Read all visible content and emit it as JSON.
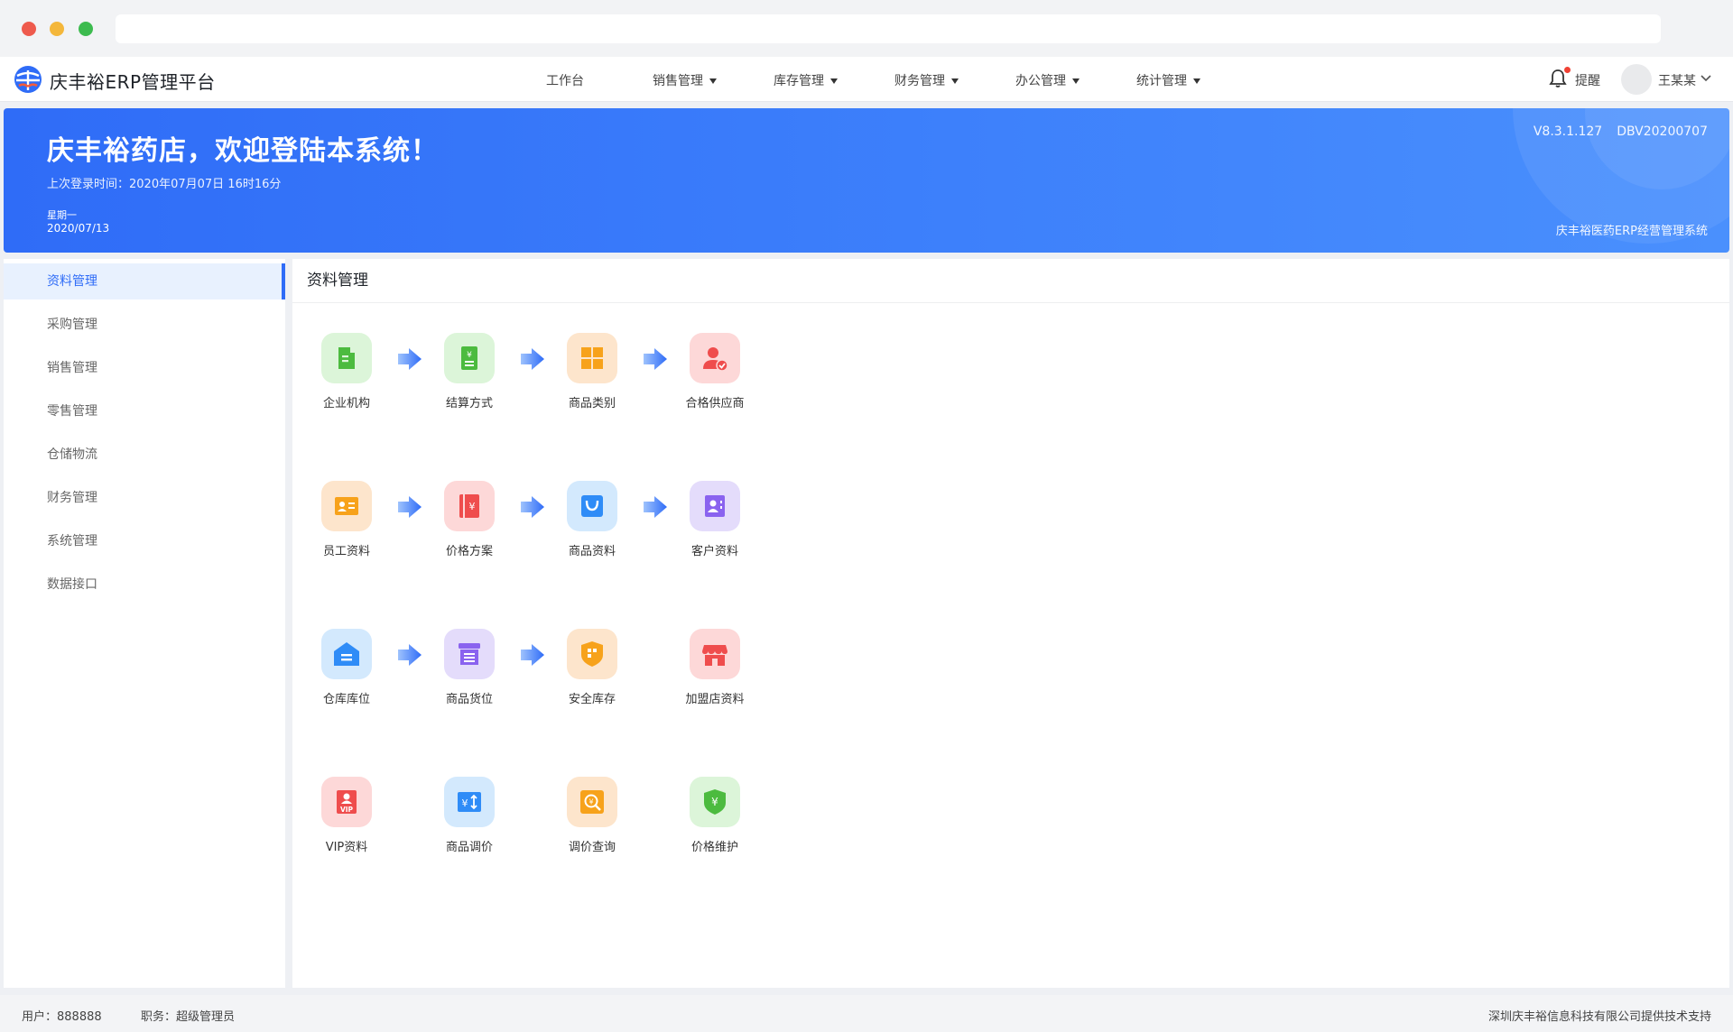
{
  "app": {
    "title": "庆丰裕ERP管理平台"
  },
  "topnav": {
    "items": [
      {
        "label": "工作台",
        "dropdown": false
      },
      {
        "label": "销售管理",
        "dropdown": true
      },
      {
        "label": "库存管理",
        "dropdown": true
      },
      {
        "label": "财务管理",
        "dropdown": true
      },
      {
        "label": "办公管理",
        "dropdown": true
      },
      {
        "label": "统计管理",
        "dropdown": true
      }
    ],
    "remind_label": "提醒",
    "username": "王某某"
  },
  "banner": {
    "welcome": "庆丰裕药店，欢迎登陆本系统！",
    "last_login": "上次登录时间：2020年07月07日 16时16分",
    "weekday": "星期一",
    "date": "2020/07/13",
    "version": "V8.3.1.127",
    "db_version": "DBV20200707",
    "system_name": "庆丰裕医药ERP经营管理系统"
  },
  "sidebar": {
    "items": [
      {
        "label": "资料管理",
        "active": true
      },
      {
        "label": "采购管理",
        "active": false
      },
      {
        "label": "销售管理",
        "active": false
      },
      {
        "label": "零售管理",
        "active": false
      },
      {
        "label": "仓储物流",
        "active": false
      },
      {
        "label": "财务管理",
        "active": false
      },
      {
        "label": "系统管理",
        "active": false
      },
      {
        "label": "数据接口",
        "active": false
      }
    ]
  },
  "main": {
    "title": "资料管理",
    "tiles": [
      {
        "label": "企业机构",
        "icon": "building-icon"
      },
      {
        "label": "结算方式",
        "icon": "bill-icon"
      },
      {
        "label": "商品类别",
        "icon": "category-grid-icon"
      },
      {
        "label": "合格供应商",
        "icon": "verified-user-icon"
      },
      {
        "label": "员工资料",
        "icon": "id-card-icon"
      },
      {
        "label": "价格方案",
        "icon": "price-book-icon"
      },
      {
        "label": "商品资料",
        "icon": "shopping-bag-icon"
      },
      {
        "label": "客户资料",
        "icon": "contact-card-icon"
      },
      {
        "label": "仓库库位",
        "icon": "warehouse-icon"
      },
      {
        "label": "商品货位",
        "icon": "archive-box-icon"
      },
      {
        "label": "安全库存",
        "icon": "shield-box-icon"
      },
      {
        "label": "加盟店资料",
        "icon": "store-icon"
      },
      {
        "label": "VIP资料",
        "icon": "vip-card-icon"
      },
      {
        "label": "商品调价",
        "icon": "price-adjust-icon"
      },
      {
        "label": "调价查询",
        "icon": "price-search-icon"
      },
      {
        "label": "价格维护",
        "icon": "price-shield-icon"
      }
    ],
    "colors": {
      "green": "#dcf5d9",
      "orange": "#fde5cc",
      "red": "#fdd8d8",
      "blue": "#d3e9fd",
      "purple": "#e4dcfb"
    }
  },
  "footer": {
    "user": "用户：888888",
    "role": "职务：超级管理员",
    "credit": "深圳庆丰裕信息科技有限公司提供技术支持"
  },
  "theme": {
    "accent": "#2f6cf7"
  }
}
